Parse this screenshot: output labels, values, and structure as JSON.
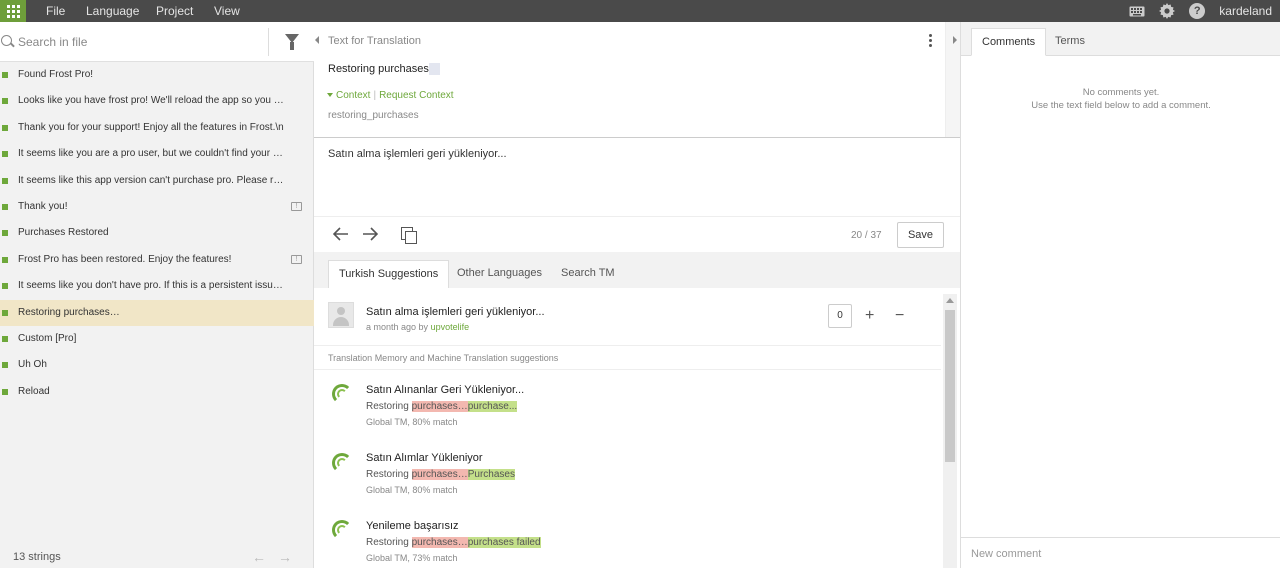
{
  "menu": {
    "file": "File",
    "language": "Language",
    "project": "Project",
    "view": "View"
  },
  "user": {
    "name": "kardeland"
  },
  "left": {
    "search_placeholder": "Search in file",
    "strings": [
      {
        "text": "Found Frost Pro!",
        "has_comment": false,
        "translated": true
      },
      {
        "text": "Looks like you have frost pro! We'll reload the app so you can enjoy all the features.",
        "has_comment": false,
        "translated": true
      },
      {
        "text": "Thank you for your support! Enjoy all the features in Frost.\\n",
        "has_comment": false,
        "translated": true
      },
      {
        "text": "It seems like you are a pro user, but we couldn't find your purchase.",
        "has_comment": false,
        "translated": true
      },
      {
        "text": "It seems like this app version can't purchase pro. Please reinstall.",
        "has_comment": false,
        "translated": true
      },
      {
        "text": "Thank you!",
        "has_comment": true,
        "translated": true
      },
      {
        "text": "Purchases Restored",
        "has_comment": false,
        "translated": true
      },
      {
        "text": "Frost Pro has been restored. Enjoy the features!",
        "has_comment": true,
        "translated": true
      },
      {
        "text": "It seems like you don't have pro. If this is a persistent issue, please contact us.",
        "has_comment": false,
        "translated": true
      },
      {
        "text": "Restoring purchases…",
        "has_comment": false,
        "translated": true,
        "active": true
      },
      {
        "text": "Custom [Pro]",
        "has_comment": false,
        "translated": true
      },
      {
        "text": "Uh Oh",
        "has_comment": false,
        "translated": true
      },
      {
        "text": "Reload",
        "has_comment": false,
        "translated": true
      }
    ],
    "footer_count": "13 strings"
  },
  "editor": {
    "source_heading": "Text for Translation",
    "source_text": "Restoring purchases",
    "source_ellipsis": "…",
    "context_label": "Context",
    "request_context": "Request Context",
    "context_key": "restoring_purchases",
    "translation": "Satın alma işlemleri geri yükleniyor...",
    "counter": "20 / 37",
    "save_label": "Save"
  },
  "suggestions": {
    "tabs": [
      "Turkish Suggestions",
      "Other Languages",
      "Search TM"
    ],
    "user_suggestion": {
      "text": "Satın alma işlemleri geri yükleniyor...",
      "time": "a month ago by",
      "author": "upvotelife",
      "votes": "0"
    },
    "tm_header": "Translation Memory and Machine Translation suggestions",
    "tm_items": [
      {
        "text": "Satın Alınanlar Geri Yükleniyor...",
        "src_plain": "Restoring ",
        "src_del": "purchases…",
        "src_ins": "purchase...",
        "meta": "Global TM, 80% match"
      },
      {
        "text": "Satın Alımlar Yükleniyor",
        "src_plain": "Restoring ",
        "src_del": "purchases…",
        "src_ins": "Purchases",
        "meta": "Global TM, 80% match"
      },
      {
        "text": "Yenileme başarısız",
        "src_plain": "Restoring ",
        "src_del": "purchases…",
        "src_ins": "purchases failed",
        "meta": "Global TM, 73% match"
      }
    ]
  },
  "right": {
    "tabs": [
      "Comments",
      "Terms"
    ],
    "empty_line1": "No comments yet.",
    "empty_line2": "Use the text field below to add a comment.",
    "new_comment_placeholder": "New comment"
  },
  "colors": {
    "accent_green": "#6ea83b",
    "topbar": "#4a4a4a",
    "active_row": "#f1e6c7",
    "diff_deleted": "#f3b8b0",
    "diff_inserted": "#c4e08a"
  },
  "icons": [
    "apps-grid-icon",
    "keyboard-icon",
    "gear-icon",
    "help-icon",
    "search-icon",
    "filter-icon",
    "kebab-menu-icon",
    "arrow-left-icon",
    "arrow-right-icon",
    "copy-source-icon",
    "plus-icon",
    "minus-icon",
    "tm-logo-icon",
    "comment-icon",
    "avatar-icon"
  ]
}
